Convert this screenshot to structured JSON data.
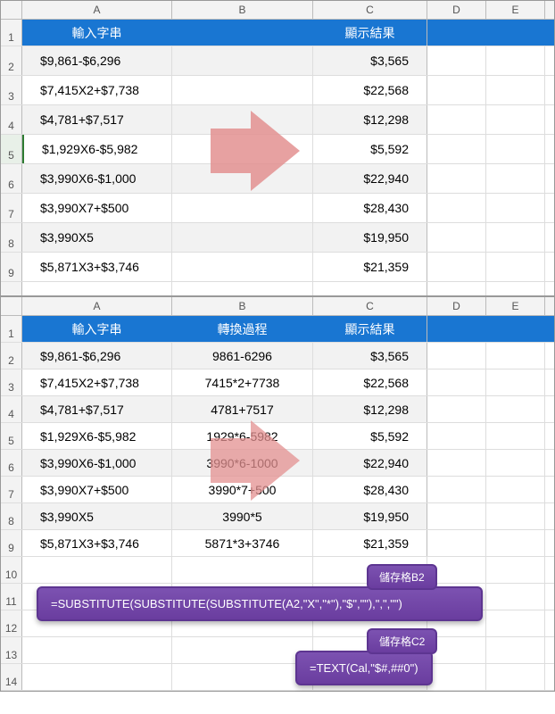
{
  "cols": [
    "A",
    "B",
    "C",
    "D",
    "E"
  ],
  "top": {
    "header": {
      "a": "輸入字串",
      "b": "",
      "c": "顯示結果"
    },
    "rows": [
      {
        "n": "2",
        "a": "$9,861-$6,296",
        "c": "$3,565"
      },
      {
        "n": "3",
        "a": "$7,415X2+$7,738",
        "c": "$22,568"
      },
      {
        "n": "4",
        "a": "$4,781+$7,517",
        "c": "$12,298"
      },
      {
        "n": "5",
        "a": "$1,929X6-$5,982",
        "c": "$5,592"
      },
      {
        "n": "6",
        "a": "$3,990X6-$1,000",
        "c": "$22,940"
      },
      {
        "n": "7",
        "a": "$3,990X7+$500",
        "c": "$28,430"
      },
      {
        "n": "8",
        "a": "$3,990X5",
        "c": "$19,950"
      },
      {
        "n": "9",
        "a": "$5,871X3+$3,746",
        "c": "$21,359"
      }
    ]
  },
  "bottom": {
    "header": {
      "a": "輸入字串",
      "b": "轉換過程",
      "c": "顯示結果"
    },
    "rows": [
      {
        "n": "2",
        "a": "$9,861-$6,296",
        "b": "9861-6296",
        "c": "$3,565"
      },
      {
        "n": "3",
        "a": "$7,415X2+$7,738",
        "b": "7415*2+7738",
        "c": "$22,568"
      },
      {
        "n": "4",
        "a": "$4,781+$7,517",
        "b": "4781+7517",
        "c": "$12,298"
      },
      {
        "n": "5",
        "a": "$1,929X6-$5,982",
        "b": "1929*6-5982",
        "c": "$5,592"
      },
      {
        "n": "6",
        "a": "$3,990X6-$1,000",
        "b": "3990*6-1000",
        "c": "$22,940"
      },
      {
        "n": "7",
        "a": "$3,990X7+$500",
        "b": "3990*7+500",
        "c": "$28,430"
      },
      {
        "n": "8",
        "a": "$3,990X5",
        "b": "3990*5",
        "c": "$19,950"
      },
      {
        "n": "9",
        "a": "$5,871X3+$3,746",
        "b": "5871*3+3746",
        "c": "$21,359"
      }
    ],
    "empty": [
      "10",
      "11",
      "12",
      "13",
      "14"
    ]
  },
  "formulas": {
    "tag1": "儲存格B2",
    "formula1": "=SUBSTITUTE(SUBSTITUTE(SUBSTITUTE(A2,\"X\",\"*\"),\"$\",\"\"),\",\",\"\")",
    "tag2": "儲存格C2",
    "formula2": "=TEXT(Cal,\"$#,##0\")"
  }
}
